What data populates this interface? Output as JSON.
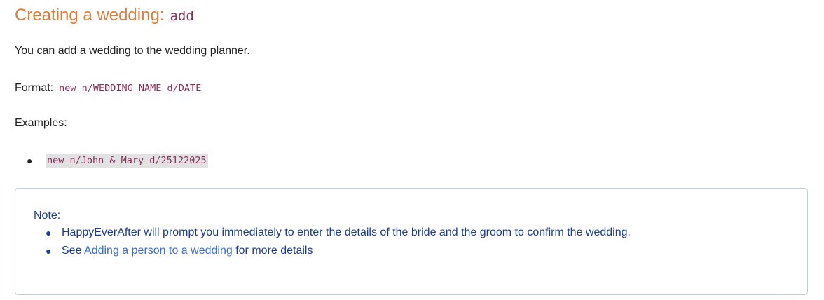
{
  "section": {
    "title": "Creating a wedding:",
    "command": "add"
  },
  "intro": "You can add a wedding to the wedding planner.",
  "format": {
    "label": "Format:",
    "syntax": "new n/WEDDING_NAME d/DATE"
  },
  "examples": {
    "label": "Examples:",
    "items": [
      "new n/John & Mary d/25122025"
    ]
  },
  "note": {
    "title": "Note:",
    "item1": "HappyEverAfter will prompt you immediately to enter the details of the bride and the groom to confirm the wedding.",
    "item2_prefix": "See",
    "item2_link": "Adding a person to a wedding",
    "item2_suffix": "for more details"
  },
  "colors": {
    "heading": "#e07b39",
    "code": "#8b2d5c",
    "note_text": "#1d3d8f",
    "note_link": "#3b6fd4",
    "note_border": "#b9cdea"
  }
}
